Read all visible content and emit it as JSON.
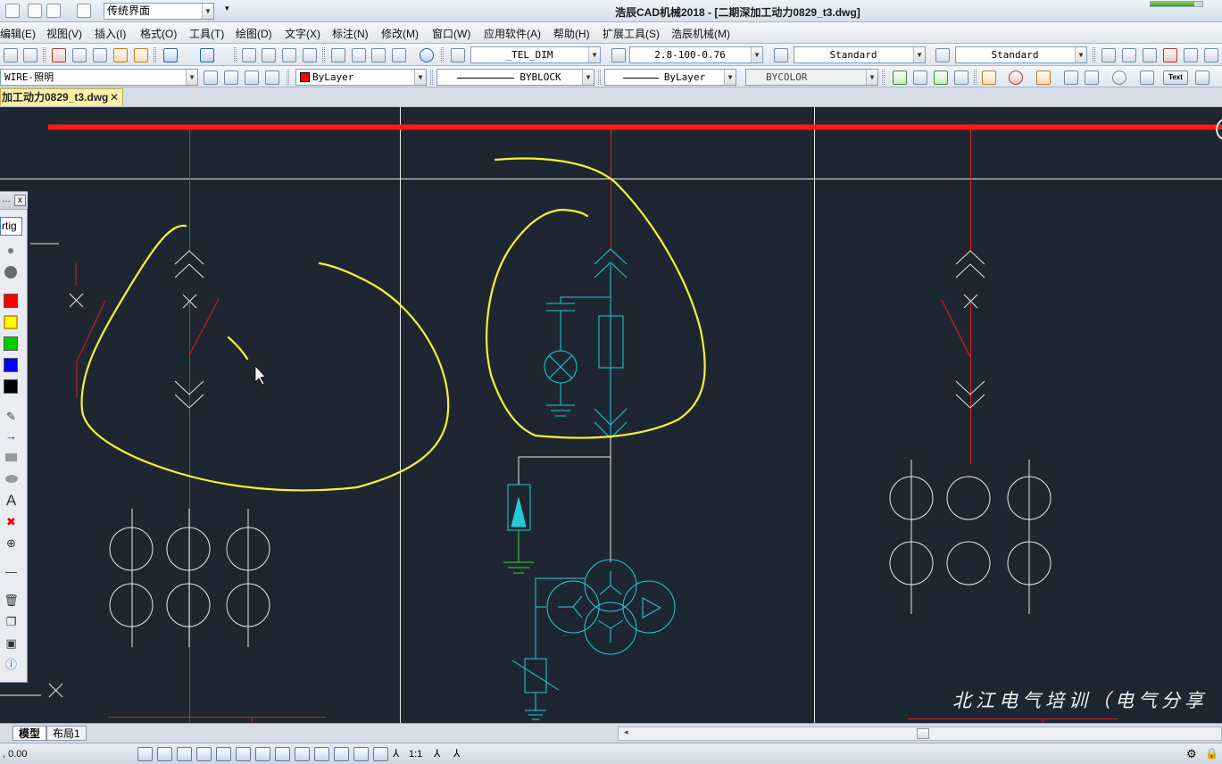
{
  "titlebar": {
    "workspace": "传统界面",
    "app_title": "浩辰CAD机械2018 - [二期深加工动力0829_t3.dwg]"
  },
  "menu": [
    {
      "label": "编辑(E)"
    },
    {
      "label": "视图(V)"
    },
    {
      "label": "插入(I)"
    },
    {
      "label": "格式(O)"
    },
    {
      "label": "工具(T)"
    },
    {
      "label": "绘图(D)"
    },
    {
      "label": "文字(X)"
    },
    {
      "label": "标注(N)"
    },
    {
      "label": "修改(M)"
    },
    {
      "label": "窗口(W)"
    },
    {
      "label": "应用软件(A)"
    },
    {
      "label": "帮助(H)"
    },
    {
      "label": "扩展工具(S)"
    },
    {
      "label": "浩辰机械(M)"
    }
  ],
  "toolbar1": {
    "text_style": "_TEL_DIM",
    "dim_style": "2.8-100-0.76",
    "table_style": "Standard",
    "multileader_style": "Standard"
  },
  "toolbar2": {
    "layer": "WIRE-照明",
    "color": "ByLayer",
    "linetype": "BYBLOCK",
    "lineweight": "ByLayer",
    "plotstyle": "BYCOLOR",
    "text_btn": "Text"
  },
  "doc_tab": {
    "label": "加工动力0829_t3.dwg",
    "close": "✕"
  },
  "side_panel": {
    "top_button": "rtig",
    "close": "x",
    "text_tool": "A"
  },
  "layout_tabs": [
    {
      "label": "模型"
    },
    {
      "label": "布局1"
    }
  ],
  "status": {
    "coords": ", 0.00",
    "scale": "1:1"
  },
  "watermark": "北江电气培训（电气分享",
  "colors": {
    "canvas_bg": "#1e2731",
    "bus_red": "#ff1a1a",
    "wire_red": "#e01e1e",
    "symbol_white": "#e8e8e8",
    "symbol_cyan": "#27c9d6",
    "annotation_yellow": "#f2f23a",
    "ground_green": "#3fd13f"
  }
}
